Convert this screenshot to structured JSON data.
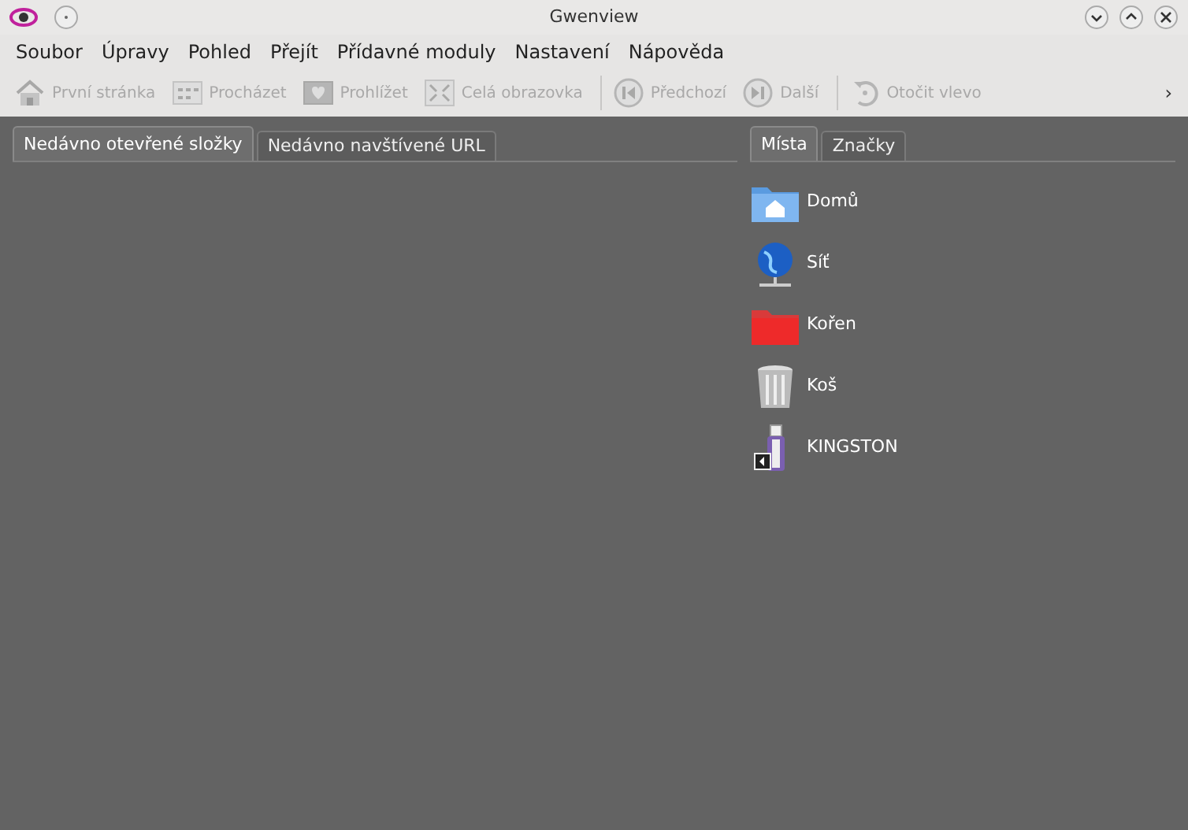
{
  "window": {
    "title": "Gwenview"
  },
  "menu": [
    "Soubor",
    "Úpravy",
    "Pohled",
    "Přejít",
    "Přídavné moduly",
    "Nastavení",
    "Nápověda"
  ],
  "toolbar": [
    {
      "label": "První stránka",
      "kind": "house",
      "disabled": true
    },
    {
      "label": "Procházet",
      "kind": "grid",
      "disabled": true
    },
    {
      "label": "Prohlížet",
      "kind": "photo",
      "disabled": true
    },
    {
      "label": "Celá obrazovka",
      "kind": "fullscreen",
      "disabled": true
    },
    {
      "label": "Předchozí",
      "kind": "prev",
      "disabled": true,
      "separator_before": true
    },
    {
      "label": "Další",
      "kind": "next",
      "disabled": true
    },
    {
      "label": "Otočit vlevo",
      "kind": "rotate",
      "disabled": true,
      "separator_before": true
    }
  ],
  "toolbar_overflow": "›",
  "left_tabs": [
    {
      "label": "Nedávno otevřené složky",
      "selected": true
    },
    {
      "label": "Nedávno navštívené URL",
      "selected": false
    }
  ],
  "right_tabs": [
    {
      "label": "Místa",
      "selected": true
    },
    {
      "label": "Značky",
      "selected": false
    }
  ],
  "places": [
    {
      "label": "Domů",
      "kind": "home"
    },
    {
      "label": "Síť",
      "kind": "network"
    },
    {
      "label": "Kořen",
      "kind": "root"
    },
    {
      "label": "Koš",
      "kind": "trash"
    },
    {
      "label": "KINGSTON",
      "kind": "usb"
    }
  ]
}
